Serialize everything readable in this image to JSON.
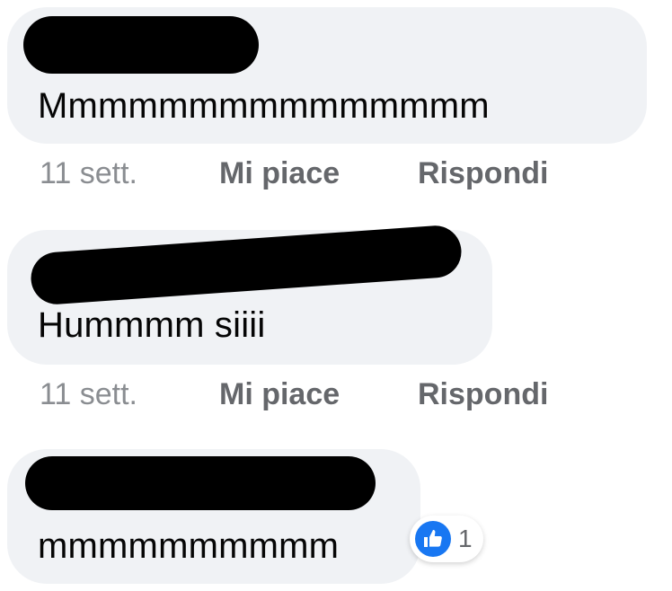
{
  "comments": [
    {
      "text": "Mmmmmmmmmmmmmmm",
      "time": "11 sett.",
      "like_label": "Mi piace",
      "reply_label": "Rispondi"
    },
    {
      "text": "Hummmm siiii",
      "time": "11 sett.",
      "like_label": "Mi piace",
      "reply_label": "Rispondi"
    },
    {
      "text": "mmmmmmmmmm",
      "reaction": {
        "icon": "thumbs-up-icon",
        "count": "1",
        "color": "#1877f2"
      }
    }
  ],
  "colors": {
    "bubble": "#f0f2f5",
    "text": "#050505",
    "meta": "#65676b",
    "timestamp": "#8a8d91"
  }
}
